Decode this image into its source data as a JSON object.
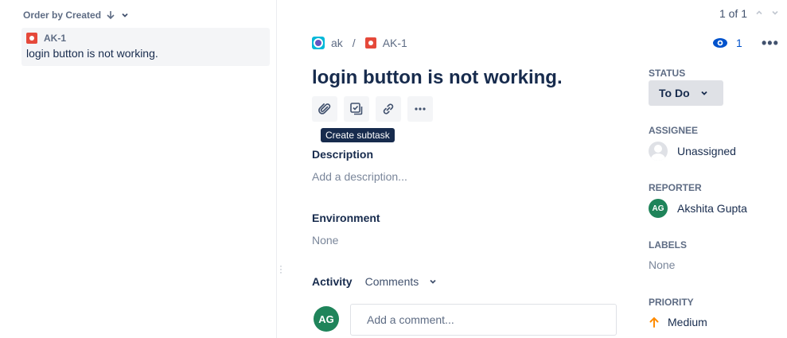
{
  "left_panel": {
    "order_by_label": "Order by Created",
    "issues": [
      {
        "key": "AK-1",
        "summary": "login button is not working."
      }
    ]
  },
  "pager": {
    "label": "1 of 1"
  },
  "breadcrumb": {
    "project": "ak",
    "separator": "/",
    "issue_key": "AK-1"
  },
  "issue": {
    "title": "login button is not working.",
    "tooltip": "Create subtask",
    "description_label": "Description",
    "description_placeholder": "Add a description...",
    "environment_label": "Environment",
    "environment_value": "None"
  },
  "activity": {
    "label": "Activity",
    "filter": "Comments",
    "avatar_initials": "AG",
    "comment_placeholder": "Add a comment..."
  },
  "header_actions": {
    "watchers_count": "1",
    "more_label": "•••"
  },
  "sidebar": {
    "status_label": "STATUS",
    "status_value": "To Do",
    "assignee_label": "ASSIGNEE",
    "assignee_value": "Unassigned",
    "reporter_label": "REPORTER",
    "reporter_initials": "AG",
    "reporter_value": "Akshita Gupta",
    "labels_label": "LABELS",
    "labels_value": "None",
    "priority_label": "PRIORITY",
    "priority_value": "Medium"
  },
  "colors": {
    "bug": "#e5493a",
    "avatar_green": "#1f845a",
    "link_blue": "#0052cc",
    "priority_orange": "#ff8b00",
    "tooltip_bg": "#172b4d"
  }
}
